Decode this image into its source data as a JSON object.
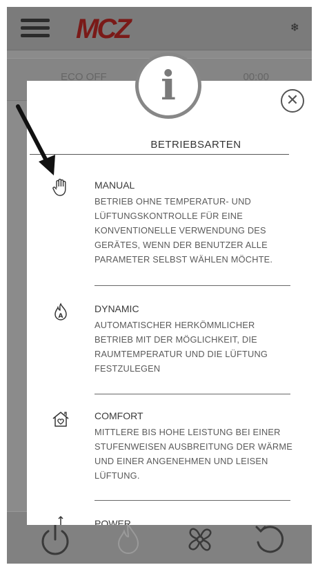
{
  "app": {
    "logo_text": "MCZ",
    "top_left_status": "ECO OFF",
    "top_right_status": "00:00",
    "brand_color": "#7a1a18"
  },
  "modal": {
    "title": "BETRIEBSARTEN",
    "close_icon": "close-icon",
    "info_icon": "info-icon",
    "modes": [
      {
        "name": "MANUAL",
        "icon": "hand-icon",
        "description": "BETRIEB OHNE TEMPERATUR- UND LÜFTUNGSKONTROLLE FÜR EINE KONVENTIONELLE VERWENDUNG DES GERÄTES, WENN DER BENUTZER ALLE PARAMETER SELBST WÄHLEN MÖCHTE."
      },
      {
        "name": "DYNAMIC",
        "icon": "flame-auto-icon",
        "description": "AUTOMATISCHER HERKÖMMLICHER BETRIEB MIT DER MÖGLICHKEIT, DIE RAUMTEMPERATUR UND DIE LÜFTUNG FESTZULEGEN"
      },
      {
        "name": "COMFORT",
        "icon": "house-heart-icon",
        "description": "MITTLERE BIS HOHE LEISTUNG BEI EINER STUFENWEISEN AUSBREITUNG DER WÄRME UND EINER ANGENEHMEN UND LEISEN LÜFTUNG."
      },
      {
        "name": "POWER",
        "icon": "power-mode-icon",
        "description": ""
      }
    ]
  },
  "bottom_bar": {
    "icons": [
      "power-icon",
      "flame-icon",
      "fan-icon",
      "refresh-icon"
    ]
  }
}
